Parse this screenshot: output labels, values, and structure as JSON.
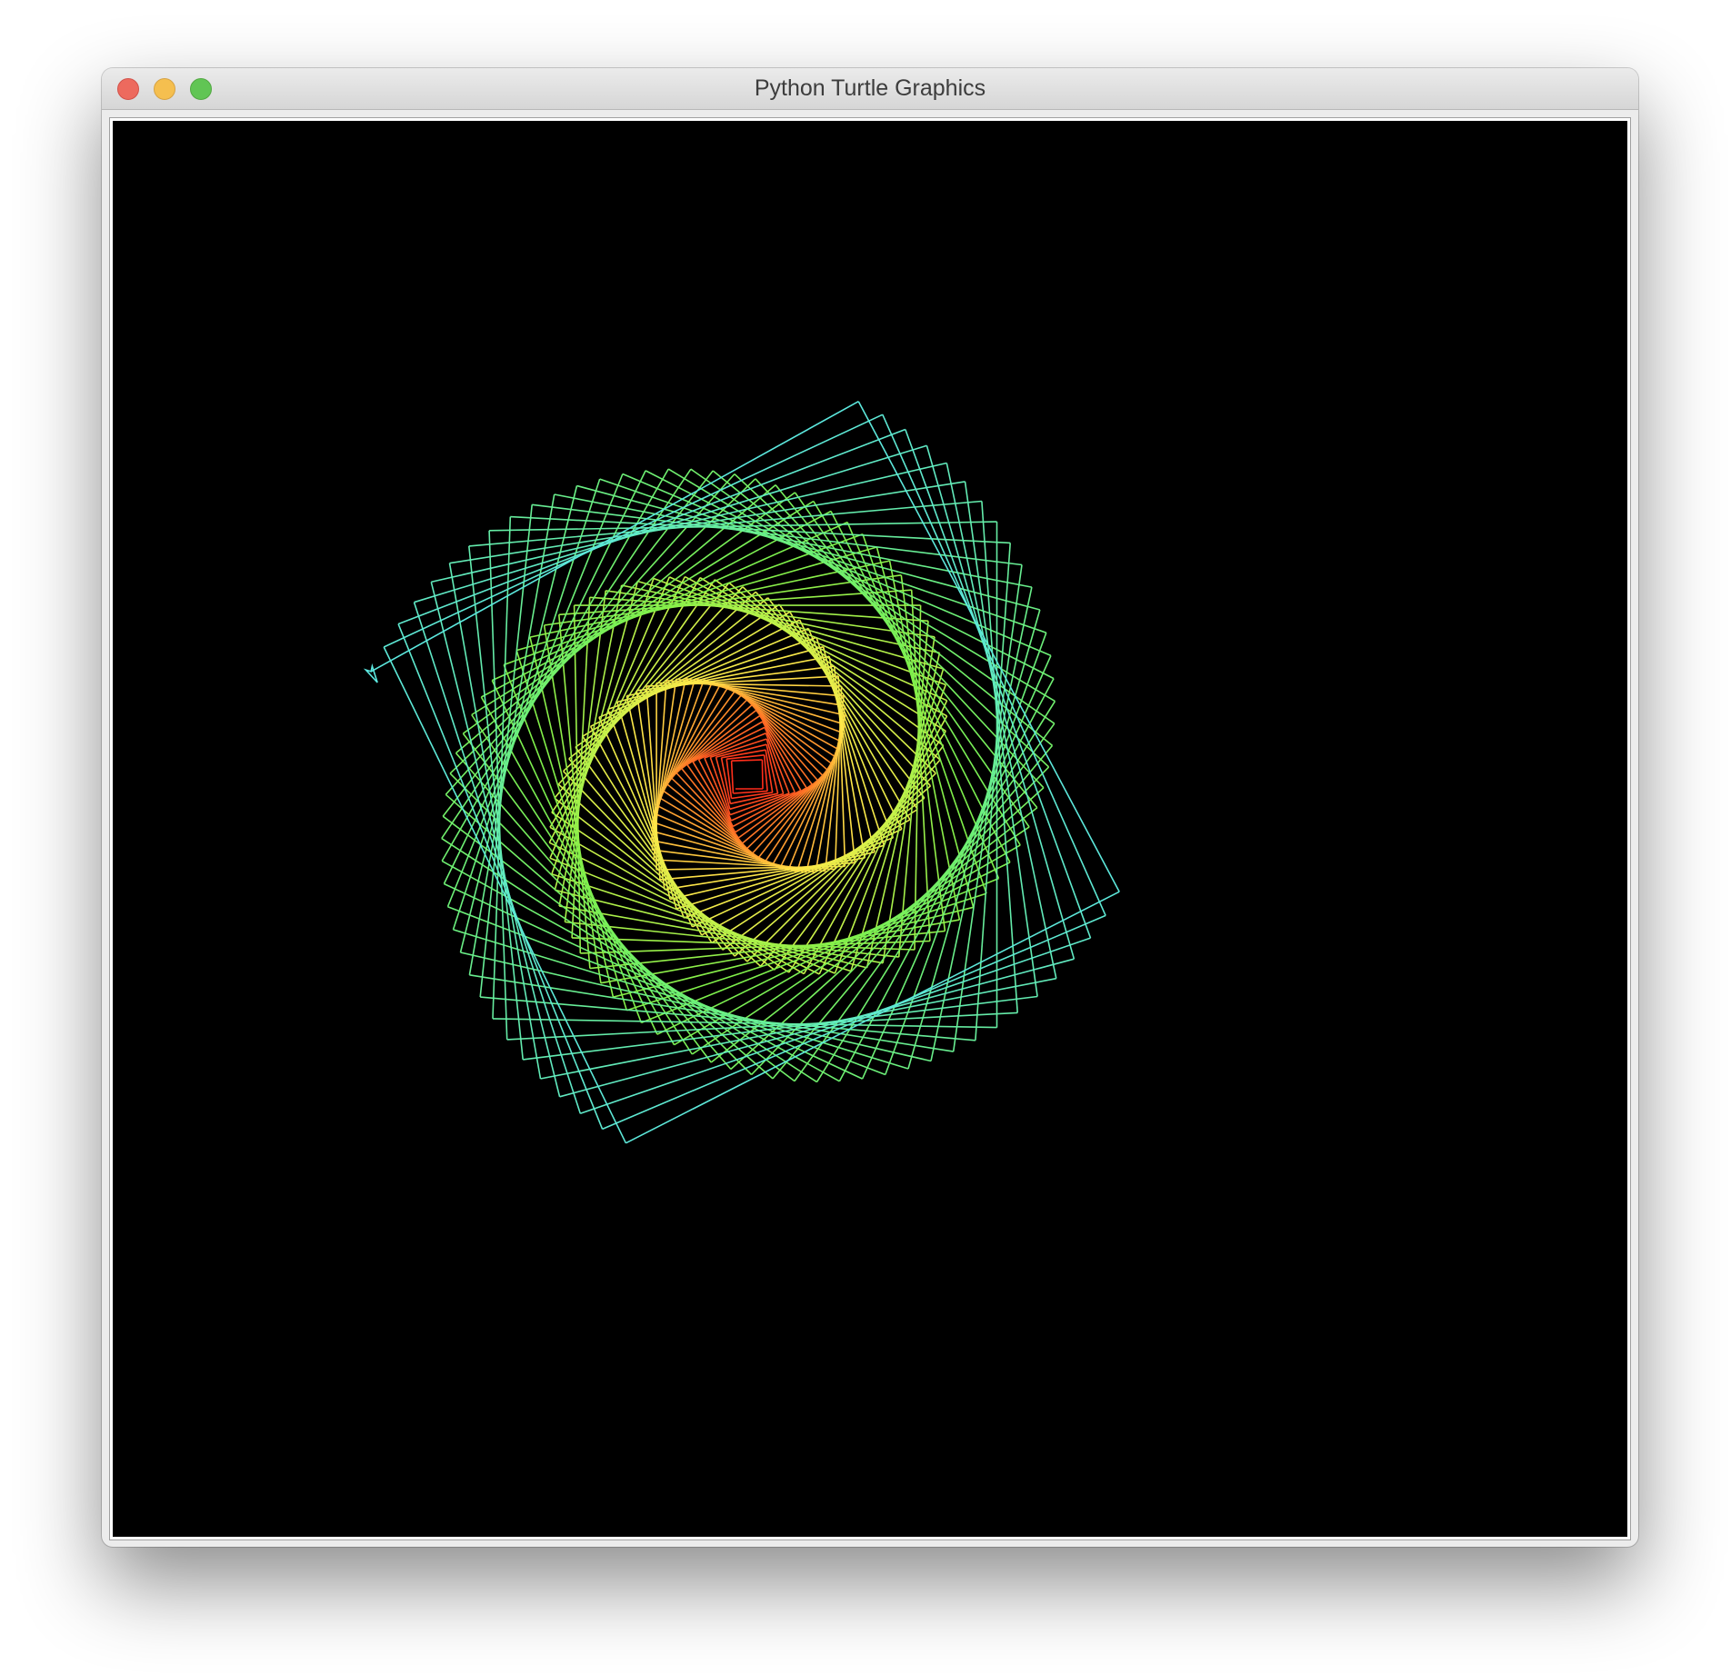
{
  "window": {
    "title": "Python Turtle Graphics"
  },
  "controls": {
    "close_icon": "close-icon",
    "minimize_icon": "minimize-icon",
    "zoom_icon": "zoom-icon"
  },
  "canvas": {
    "background": "#000000",
    "drawing": "square-spiral-rainbow",
    "colors": [
      "#ff2a1a",
      "#ff8a2a",
      "#ffe94a",
      "#c8f24a",
      "#7ff04a",
      "#6cf07a",
      "#5ce8e0"
    ]
  }
}
